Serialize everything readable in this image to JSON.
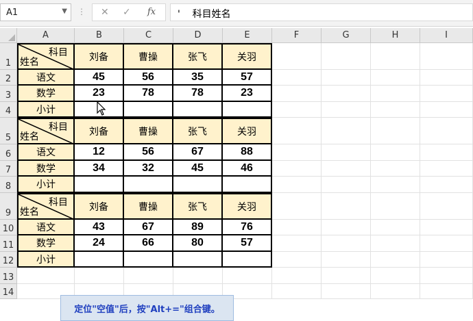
{
  "formula_bar": {
    "name_box": "A1",
    "separator": "⋮",
    "cancel_icon": "✕",
    "enter_icon": "✓",
    "fx_icon": "fx",
    "formula": "'    科目姓名"
  },
  "columns": [
    "A",
    "B",
    "C",
    "D",
    "E",
    "F",
    "G",
    "H",
    "I"
  ],
  "rows": [
    "1",
    "2",
    "3",
    "4",
    "5",
    "6",
    "7",
    "8",
    "9",
    "10",
    "11",
    "12",
    "13",
    "14"
  ],
  "corner_header": {
    "top": "科目",
    "bottom": "姓名"
  },
  "blocks": [
    {
      "names": [
        "刘备",
        "曹操",
        "张飞",
        "关羽"
      ],
      "rows": [
        {
          "label": "语文",
          "values": [
            "45",
            "56",
            "35",
            "57"
          ]
        },
        {
          "label": "数学",
          "values": [
            "23",
            "78",
            "78",
            "23"
          ]
        },
        {
          "label": "小计",
          "values": [
            "",
            "",
            "",
            ""
          ]
        }
      ]
    },
    {
      "names": [
        "刘备",
        "曹操",
        "张飞",
        "关羽"
      ],
      "rows": [
        {
          "label": "语文",
          "values": [
            "12",
            "56",
            "67",
            "88"
          ]
        },
        {
          "label": "数学",
          "values": [
            "34",
            "32",
            "45",
            "46"
          ]
        },
        {
          "label": "小计",
          "values": [
            "",
            "",
            "",
            ""
          ]
        }
      ]
    },
    {
      "names": [
        "刘备",
        "曹操",
        "张飞",
        "关羽"
      ],
      "rows": [
        {
          "label": "语文",
          "values": [
            "43",
            "67",
            "89",
            "76"
          ]
        },
        {
          "label": "数学",
          "values": [
            "24",
            "66",
            "80",
            "57"
          ]
        },
        {
          "label": "小计",
          "values": [
            "",
            "",
            "",
            ""
          ]
        }
      ]
    }
  ],
  "hint": "定位\"空值\"后，按\"Alt+=\"组合键。",
  "colors": {
    "header_fill": "#fff2cc",
    "hint_fill": "#dbe5f1",
    "hint_text": "#1f3fbf"
  }
}
